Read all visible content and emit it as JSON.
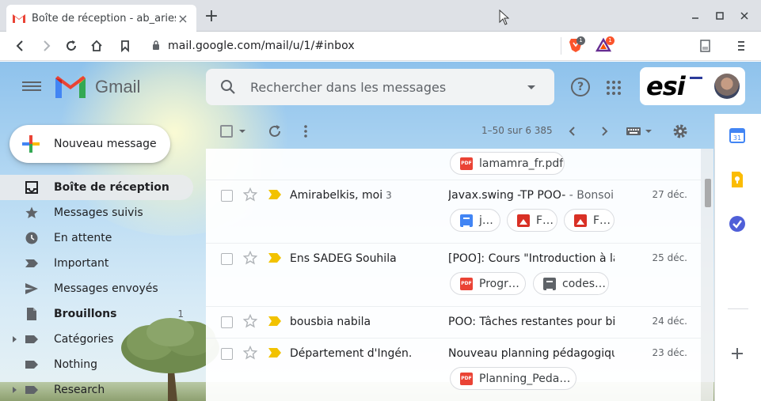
{
  "browser": {
    "tab_title": "Boîte de réception - ab_aries@esi.dz",
    "tab_close": "×",
    "new_tab": "+",
    "url": "mail.google.com/mail/u/1/#inbox",
    "brave_badge": "1",
    "bat_badge": "1"
  },
  "gmail": {
    "product_name": "Gmail",
    "search_placeholder": "Rechercher dans les messages",
    "account_logo_text": "esi",
    "compose_label": "Nouveau message",
    "nav": [
      {
        "label": "Boîte de réception",
        "icon": "inbox-icon",
        "active": true,
        "count": ""
      },
      {
        "label": "Messages suivis",
        "icon": "star-icon",
        "active": false,
        "count": ""
      },
      {
        "label": "En attente",
        "icon": "clock-icon",
        "active": false,
        "count": ""
      },
      {
        "label": "Important",
        "icon": "label-important-icon",
        "active": false,
        "count": ""
      },
      {
        "label": "Messages envoyés",
        "icon": "send-icon",
        "active": false,
        "count": ""
      },
      {
        "label": "Brouillons",
        "icon": "draft-icon",
        "active": false,
        "count": "1"
      },
      {
        "label": "Catégories",
        "icon": "label-icon",
        "active": false,
        "count": ""
      },
      {
        "label": "Nothing",
        "icon": "label-icon",
        "active": false,
        "count": ""
      },
      {
        "label": "Research",
        "icon": "label-icon",
        "active": false,
        "count": ""
      }
    ],
    "pager": "1–50 sur 6 385",
    "emails": [
      {
        "from": "",
        "count": "",
        "subject": "",
        "snippet": "",
        "date": "",
        "attachments": [
          {
            "type": "pdf",
            "name": "lamamra_fr.pdf"
          }
        ]
      },
      {
        "from": "Amirabelkis, moi",
        "count": "3",
        "subject": "Javax.swing -TP POO-",
        "snippet": " - Bonsoi…",
        "date": "27 déc.",
        "attachments": [
          {
            "type": "doc",
            "name": "j…"
          },
          {
            "type": "img",
            "name": "F…"
          },
          {
            "type": "img",
            "name": "F…"
          }
        ]
      },
      {
        "from": "Ens SADEG Souhila",
        "count": "",
        "subject": "[POO]: Cours \"Introduction à la …",
        "snippet": "",
        "date": "25 déc.",
        "attachments": [
          {
            "type": "pdf",
            "name": "Progr…"
          },
          {
            "type": "txt",
            "name": "codes…"
          }
        ]
      },
      {
        "from": "bousbia nabila",
        "count": "",
        "subject": "POO: Tâches restantes pour bi…",
        "snippet": "",
        "date": "24 déc.",
        "attachments": []
      },
      {
        "from": "Département d'Ingén.",
        "count": "",
        "subject": "Nouveau planning pédagogiqu…",
        "snippet": "",
        "date": "23 déc.",
        "attachments": [
          {
            "type": "pdf",
            "name": "Planning_Peda…"
          }
        ]
      }
    ]
  }
}
